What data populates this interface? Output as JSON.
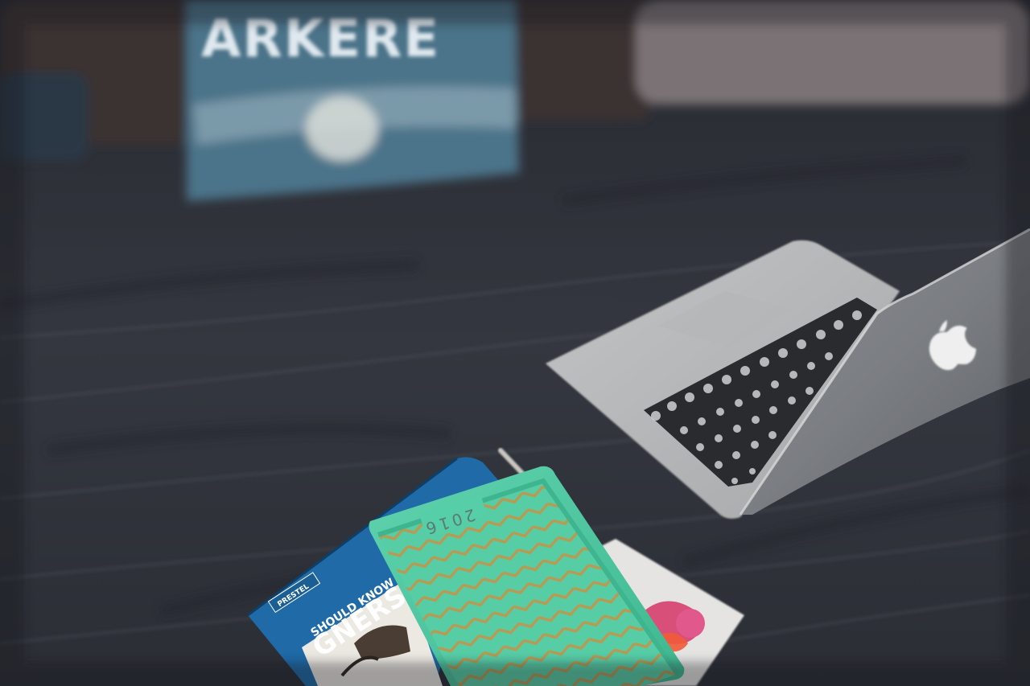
{
  "scene": {
    "pillow_text": "ARKERE",
    "green_book": {
      "year": "2016"
    },
    "blue_book": {
      "brand": "PRESTEL",
      "line1": "SHOULD KNOW",
      "line2": "GNERS"
    }
  },
  "colors": {
    "duvet": "#30333c",
    "pillow_blue": "#4c7389",
    "laptop_silver": "#b8b9bb",
    "book_mint": "#4fc9a4",
    "book_blue": "#1e6aa8",
    "chevron_gold": "#b58f4a"
  }
}
